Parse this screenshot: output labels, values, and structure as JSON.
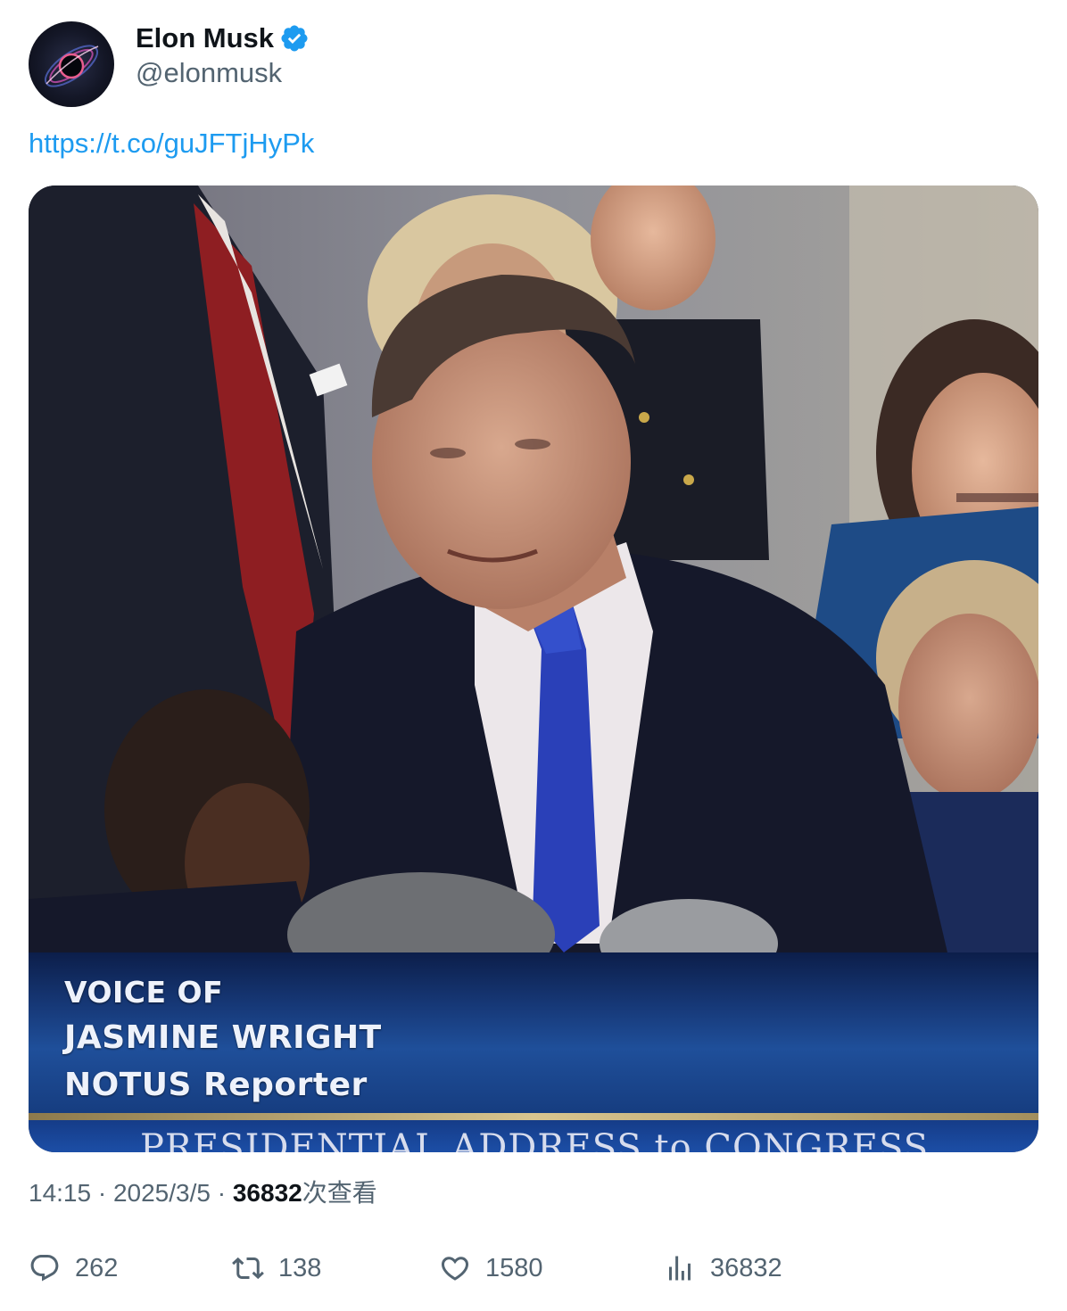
{
  "tweet": {
    "author_name": "Elon Musk",
    "handle": "@elonmusk",
    "link_text": "https://t.co/guJFTjHyPk",
    "time": "14:15",
    "date": "2025/3/5",
    "views_count": "36832",
    "views_label": "次查看",
    "separator": "·"
  },
  "media": {
    "caption_line1": "VOICE OF",
    "caption_line2": "JASMINE WRIGHT",
    "caption_line3": "NOTUS Reporter",
    "banner": "PRESIDENTIAL ADDRESS to CONGRESS"
  },
  "actions": {
    "replies": "262",
    "retweets": "138",
    "likes": "1580",
    "views": "36832"
  },
  "icons": {
    "verified": "verified-badge-icon",
    "reply": "reply-icon",
    "retweet": "retweet-icon",
    "like": "heart-icon",
    "views": "views-chart-icon"
  },
  "colors": {
    "link": "#1d9bf0",
    "verified": "#1d9bf0",
    "secondary_text": "#536471",
    "primary_text": "#0f1419"
  }
}
